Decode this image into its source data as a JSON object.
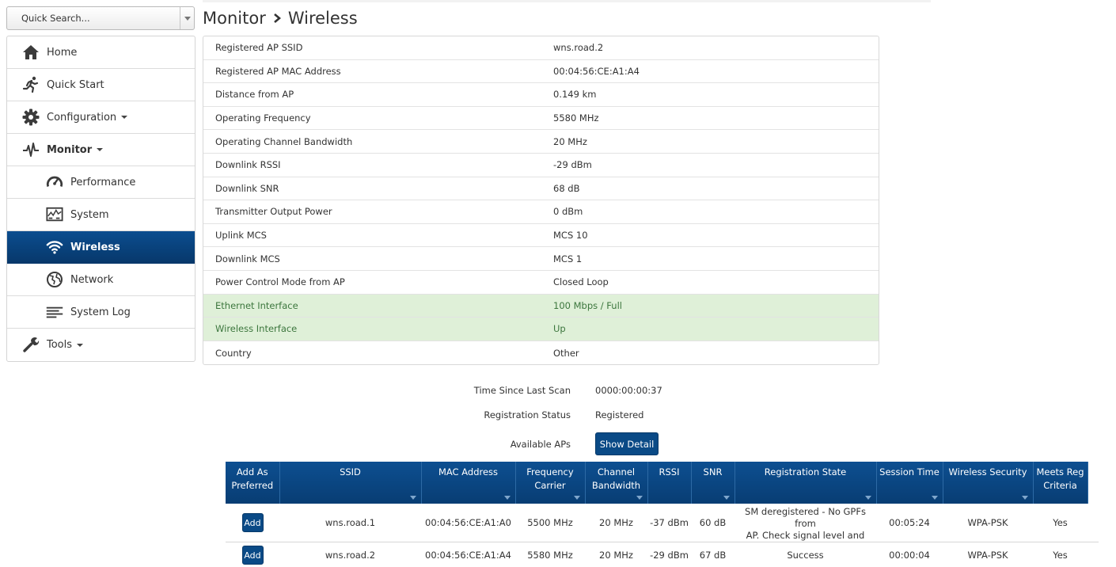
{
  "search": {
    "placeholder": "Quick Search..."
  },
  "sidebar": {
    "items": [
      {
        "label": "Home",
        "icon": "home-icon"
      },
      {
        "label": "Quick Start",
        "icon": "running-person-icon"
      },
      {
        "label": "Configuration",
        "icon": "gear-icon"
      },
      {
        "label": "Monitor",
        "icon": "pulse-icon"
      },
      {
        "label": "Performance",
        "icon": "speedometer-icon"
      },
      {
        "label": "System",
        "icon": "system-chart-icon"
      },
      {
        "label": "Wireless",
        "icon": "wifi-icon"
      },
      {
        "label": "Network",
        "icon": "globe-icon"
      },
      {
        "label": "System Log",
        "icon": "list-lines-icon"
      },
      {
        "label": "Tools",
        "icon": "wrench-icon"
      }
    ]
  },
  "breadcrumb": {
    "parent": "Monitor",
    "current": "Wireless"
  },
  "info": [
    {
      "key": "Registered AP SSID",
      "value": "wns.road.2"
    },
    {
      "key": "Registered AP MAC Address",
      "value": "00:04:56:CE:A1:A4"
    },
    {
      "key": "Distance from AP",
      "value": "0.149 km"
    },
    {
      "key": "Operating Frequency",
      "value": "5580 MHz"
    },
    {
      "key": "Operating Channel Bandwidth",
      "value": "20 MHz"
    },
    {
      "key": "Downlink RSSI",
      "value": "-29 dBm"
    },
    {
      "key": "Downlink SNR",
      "value": "68 dB"
    },
    {
      "key": "Transmitter Output Power",
      "value": "0 dBm"
    },
    {
      "key": "Uplink MCS",
      "value": "MCS 10"
    },
    {
      "key": "Downlink MCS",
      "value": "MCS 1"
    },
    {
      "key": "Power Control Mode from AP",
      "value": "Closed Loop"
    },
    {
      "key": "Ethernet Interface",
      "value": "100 Mbps / Full"
    },
    {
      "key": "Wireless Interface",
      "value": "Up"
    },
    {
      "key": "Country",
      "value": "Other"
    }
  ],
  "scan": {
    "time_label": "Time Since Last Scan",
    "time_value": "0000:00:00:37",
    "reg_label": "Registration Status",
    "reg_value": "Registered",
    "aps_label": "Available APs",
    "show_detail": "Show Detail"
  },
  "ap_table": {
    "headers": {
      "add": [
        "Add As",
        "Preferred"
      ],
      "ssid": "SSID",
      "mac": "MAC Address",
      "freq": "Frequency Carrier",
      "bw": [
        "Channel",
        "Bandwidth"
      ],
      "rssi": "RSSI",
      "snr": "SNR",
      "state": "Registration State",
      "session": "Session Time",
      "security": "Wireless Security",
      "meets": [
        "Meets Reg",
        "Criteria"
      ]
    },
    "add_label": "Add",
    "rows": [
      {
        "ssid": "wns.road.1",
        "mac": "00:04:56:CE:A1:A0",
        "freq": "5500 MHz",
        "bw": "20 MHz",
        "rssi": "-37 dBm",
        "snr": "60 dB",
        "state": [
          "SM deregistered - No GPFs from",
          "AP. Check signal level and"
        ],
        "session": "00:05:24",
        "security": "WPA-PSK",
        "meets": "Yes"
      },
      {
        "ssid": "wns.road.2",
        "mac": "00:04:56:CE:A1:A4",
        "freq": "5580 MHz",
        "bw": "20 MHz",
        "rssi": "-29 dBm",
        "snr": "67 dB",
        "state": [
          "Success"
        ],
        "session": "00:00:04",
        "security": "WPA-PSK",
        "meets": "Yes"
      }
    ]
  },
  "colors": {
    "accent": "#0a4a86",
    "ok_bg": "#dff0d8",
    "ok_text": "#3c763d"
  }
}
